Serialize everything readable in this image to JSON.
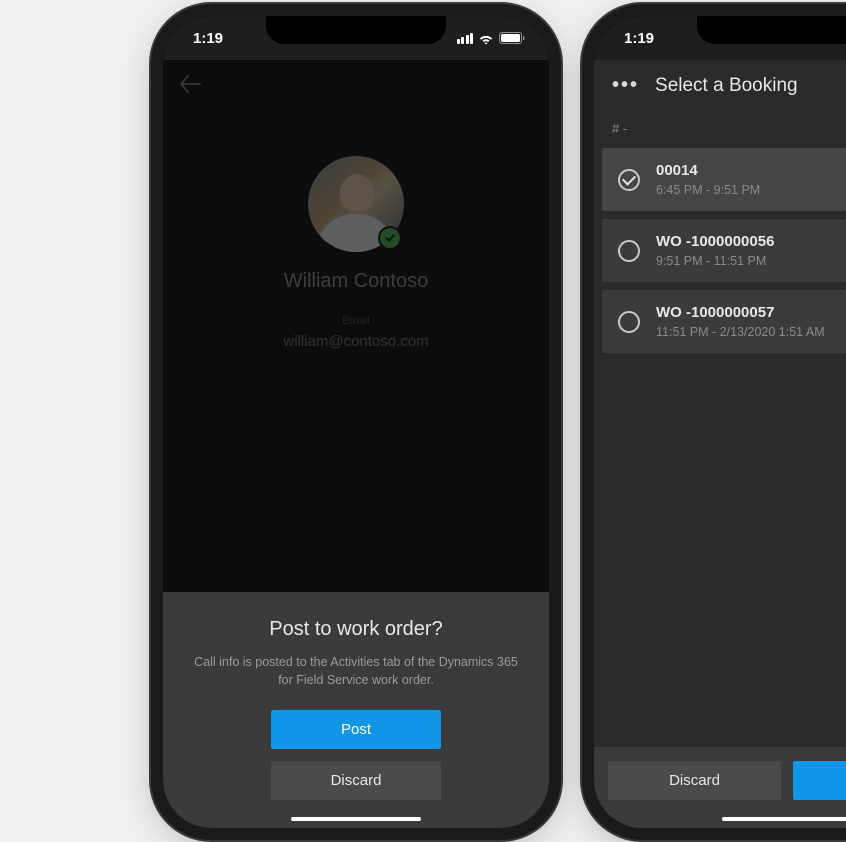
{
  "status": {
    "time": "1:19"
  },
  "phone1": {
    "profile": {
      "name": "William Contoso",
      "email_label": "Email",
      "email": "william@contoso.com"
    },
    "sheet": {
      "title": "Post to work order?",
      "description": "Call info is posted to the Activities tab of the Dynamics 365 for Field Service work order.",
      "post_label": "Post",
      "discard_label": "Discard"
    }
  },
  "phone2": {
    "header_title": "Select a Booking",
    "section_label": "# -",
    "bookings": [
      {
        "title": "00014",
        "time": "6:45 PM - 9:51 PM",
        "selected": true
      },
      {
        "title": "WO -1000000056",
        "time": "9:51 PM - 11:51 PM",
        "selected": false
      },
      {
        "title": "WO -1000000057",
        "time": "11:51 PM - 2/13/2020 1:51 AM",
        "selected": false
      }
    ],
    "discard_label": "Discard"
  }
}
